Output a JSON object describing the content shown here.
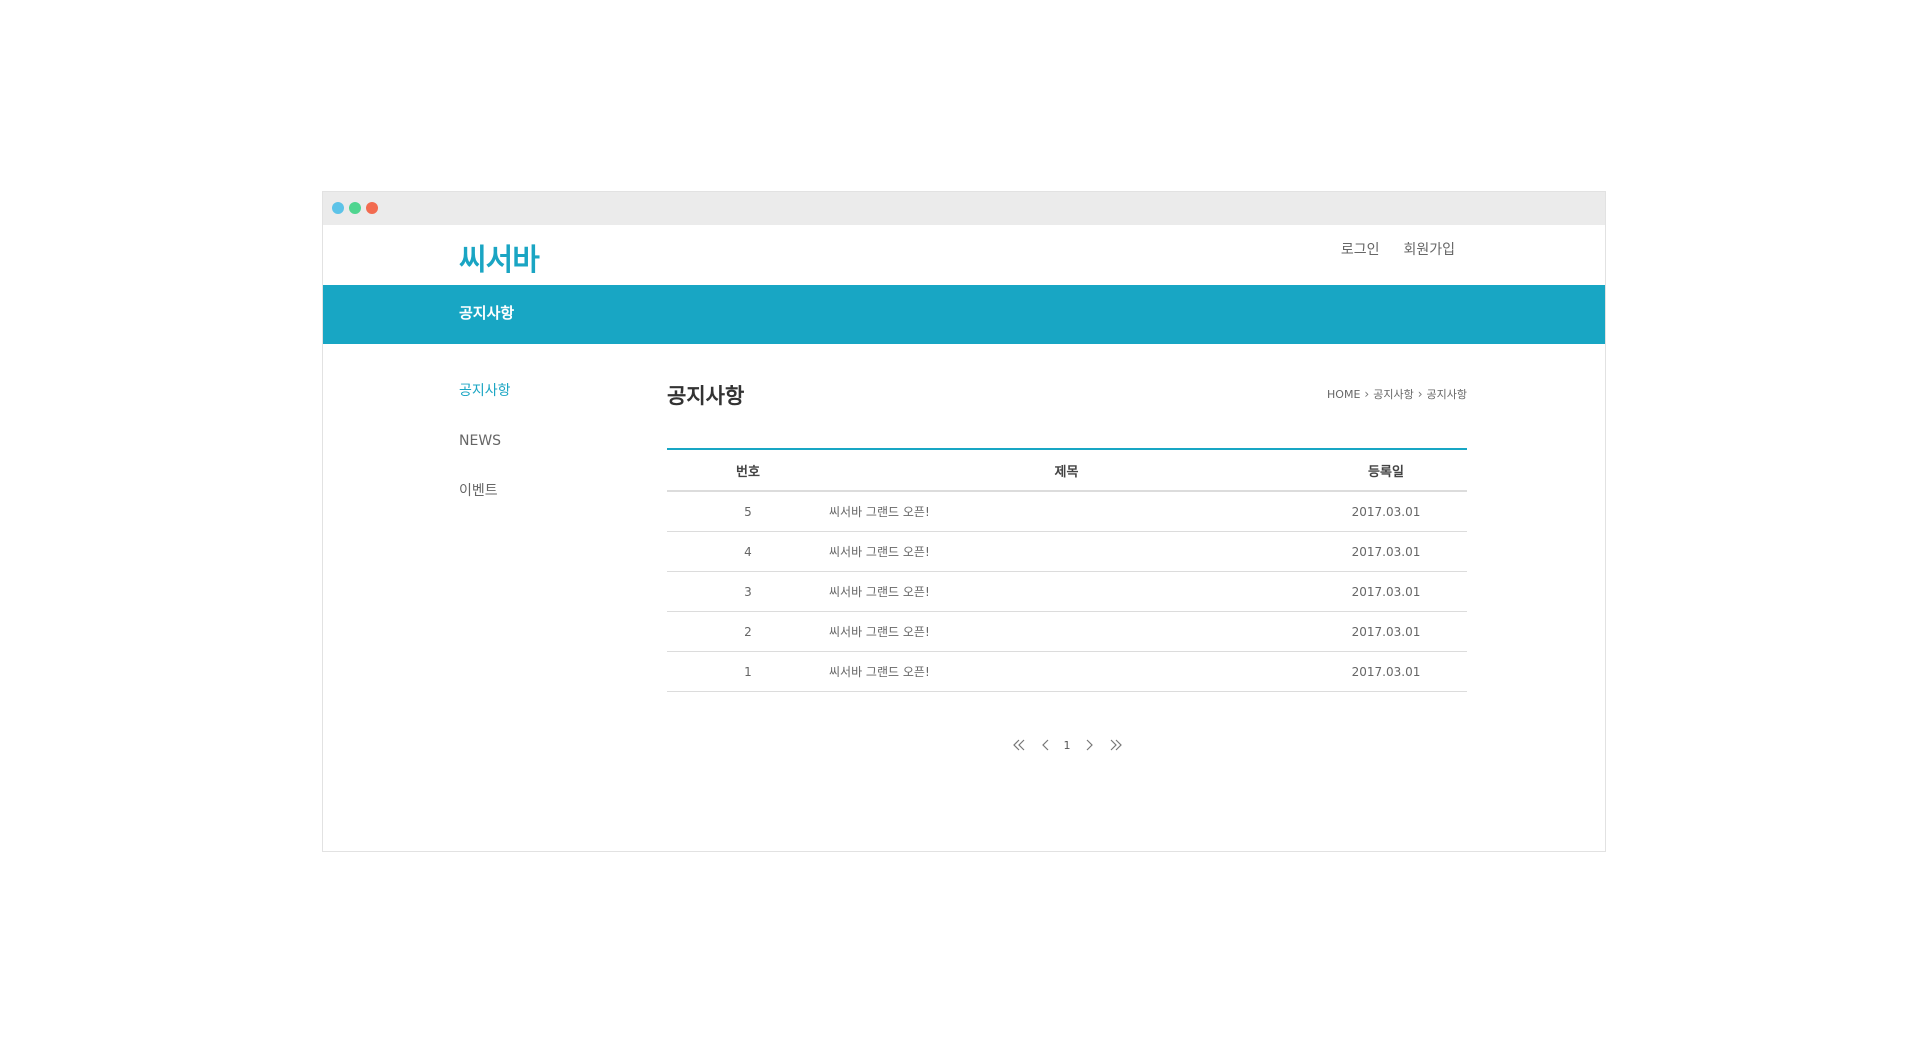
{
  "brand": {
    "logo_text": "씨서바",
    "accent_color": "#18a6c4"
  },
  "header": {
    "login_label": "로그인",
    "signup_label": "회원가입"
  },
  "banner": {
    "title": "공지사항"
  },
  "sidebar": {
    "items": [
      {
        "label": "공지사항",
        "active": true
      },
      {
        "label": "NEWS",
        "active": false
      },
      {
        "label": "이벤트",
        "active": false
      }
    ]
  },
  "main": {
    "title": "공지사항",
    "breadcrumb": [
      "HOME",
      "공지사항",
      "공지사항"
    ]
  },
  "table": {
    "headers": {
      "number": "번호",
      "title": "제목",
      "date": "등록일"
    },
    "rows": [
      {
        "number": "5",
        "title": "씨서바 그랜드 오픈!",
        "date": "2017.03.01"
      },
      {
        "number": "4",
        "title": "씨서바 그랜드 오픈!",
        "date": "2017.03.01"
      },
      {
        "number": "3",
        "title": "씨서바 그랜드 오픈!",
        "date": "2017.03.01"
      },
      {
        "number": "2",
        "title": "씨서바 그랜드 오픈!",
        "date": "2017.03.01"
      },
      {
        "number": "1",
        "title": "씨서바 그랜드 오픈!",
        "date": "2017.03.01"
      }
    ]
  },
  "pagination": {
    "current_page": "1",
    "icons": [
      "first-page-icon",
      "prev-page-icon",
      "next-page-icon",
      "last-page-icon"
    ]
  }
}
